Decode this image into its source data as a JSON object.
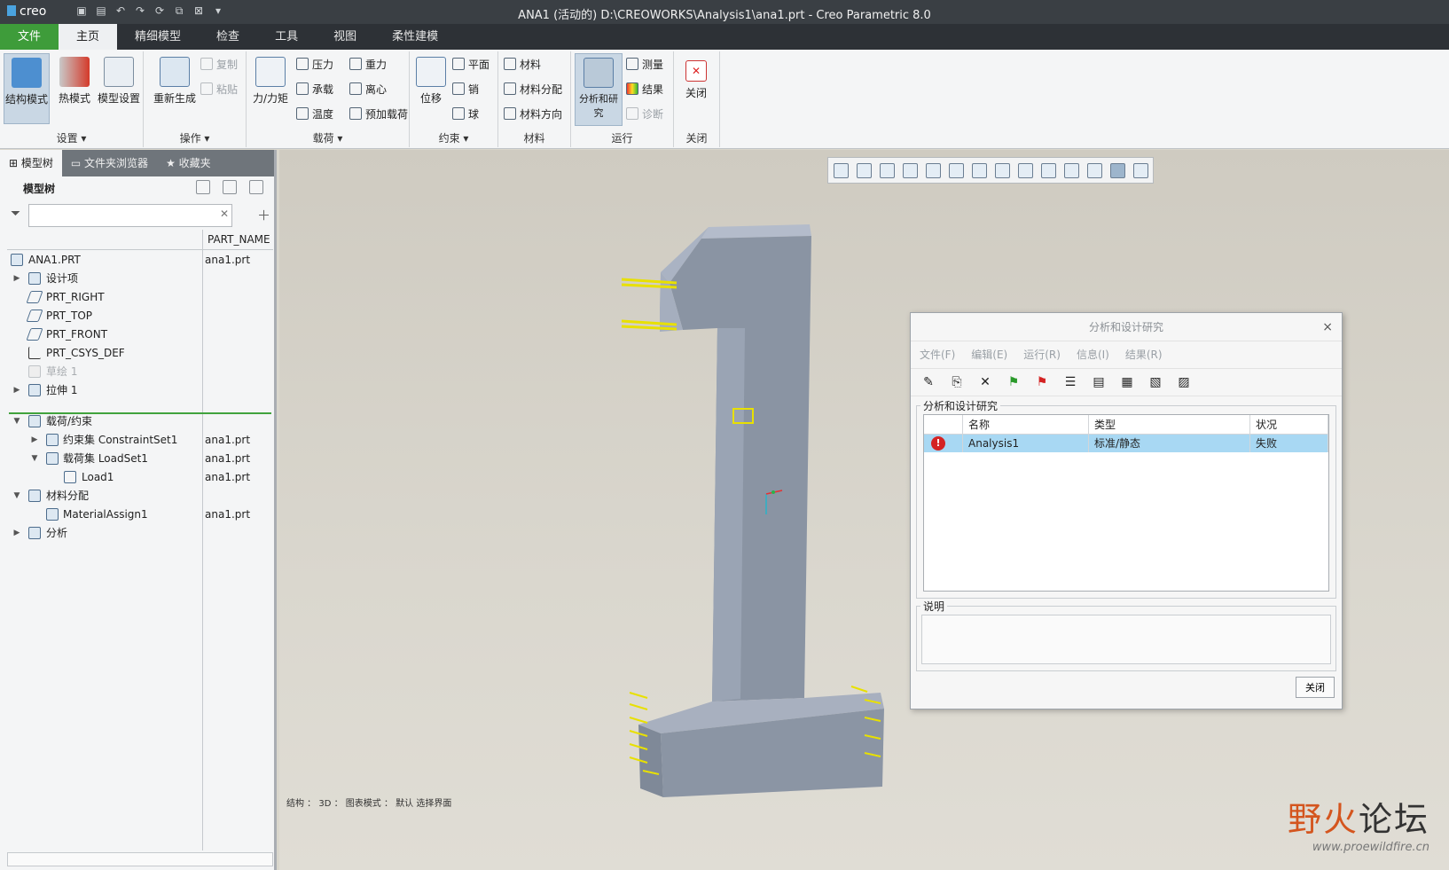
{
  "titlebar": {
    "logo": "creo",
    "title": "ANA1 (活动的) D:\\CREOWORKS\\Analysis1\\ana1.prt - Creo Parametric 8.0"
  },
  "ribbon_tabs": [
    "文件",
    "主页",
    "精细模型",
    "检查",
    "工具",
    "视图",
    "柔性建模"
  ],
  "ribbon": {
    "settings": {
      "label": "设置",
      "mode_struct": "结构模式",
      "mode_thermal": "热模式",
      "model_setup": "模型设置"
    },
    "ops": {
      "label": "操作",
      "regen": "重新生成",
      "copy": "复制",
      "paste": "粘贴"
    },
    "loads": {
      "label": "载荷",
      "force": "力/力矩",
      "pressure": "压力",
      "gravity": "重力",
      "bearing": "承载",
      "centrifugal": "离心",
      "temperature": "温度",
      "preload": "预加载荷"
    },
    "constraints": {
      "label": "约束",
      "displacement": "位移",
      "plane": "平面",
      "pin": "销",
      "ball": "球"
    },
    "materials": {
      "label": "材料",
      "material": "材料",
      "assign": "材料分配",
      "orient": "材料方向"
    },
    "run": {
      "label": "运行",
      "analysis": "分析和研究",
      "measure": "测量",
      "results": "结果",
      "diagnose": "诊断"
    },
    "close": {
      "label": "关闭",
      "button": "关闭"
    }
  },
  "left_panel": {
    "tabs": [
      "模型树",
      "文件夹浏览器",
      "收藏夹"
    ],
    "header": "模型树",
    "column": "PART_NAME",
    "tree": [
      {
        "label": "ANA1.PRT",
        "value": "ana1.prt"
      },
      {
        "label": "设计项",
        "value": ""
      },
      {
        "label": "PRT_RIGHT",
        "value": ""
      },
      {
        "label": "PRT_TOP",
        "value": ""
      },
      {
        "label": "PRT_FRONT",
        "value": ""
      },
      {
        "label": "PRT_CSYS_DEF",
        "value": ""
      },
      {
        "label": "草绘 1",
        "value": ""
      },
      {
        "label": "拉伸 1",
        "value": ""
      },
      {
        "label": "载荷/约束",
        "value": ""
      },
      {
        "label": "约束集 ConstraintSet1",
        "value": "ana1.prt"
      },
      {
        "label": "载荷集 LoadSet1",
        "value": "ana1.prt"
      },
      {
        "label": "Load1",
        "value": "ana1.prt"
      },
      {
        "label": "材料分配",
        "value": ""
      },
      {
        "label": "MaterialAssign1",
        "value": "ana1.prt"
      },
      {
        "label": "分析",
        "value": ""
      }
    ]
  },
  "viewport": {
    "status": "结构 ： 3D ： 图表模式 ： 默认 选择界面",
    "watermark_a": "野火",
    "watermark_b": "论坛",
    "watermark_url": "www.proewildfire.cn"
  },
  "dialog": {
    "title": "分析和设计研究",
    "menu": [
      "文件(F)",
      "编辑(E)",
      "运行(R)",
      "信息(I)",
      "结果(R)"
    ],
    "group_label": "分析和设计研究",
    "columns": [
      "名称",
      "类型",
      "状况"
    ],
    "rows": [
      {
        "name": "Analysis1",
        "type": "标准/静态",
        "status": "失败"
      }
    ],
    "desc_label": "说明",
    "close_button": "关闭"
  },
  "colors": {
    "file_tab": "#3e9c3a",
    "selection": "#a8d8f3",
    "part_face": "#8a94a3",
    "load_arrows": "#e8e000"
  }
}
